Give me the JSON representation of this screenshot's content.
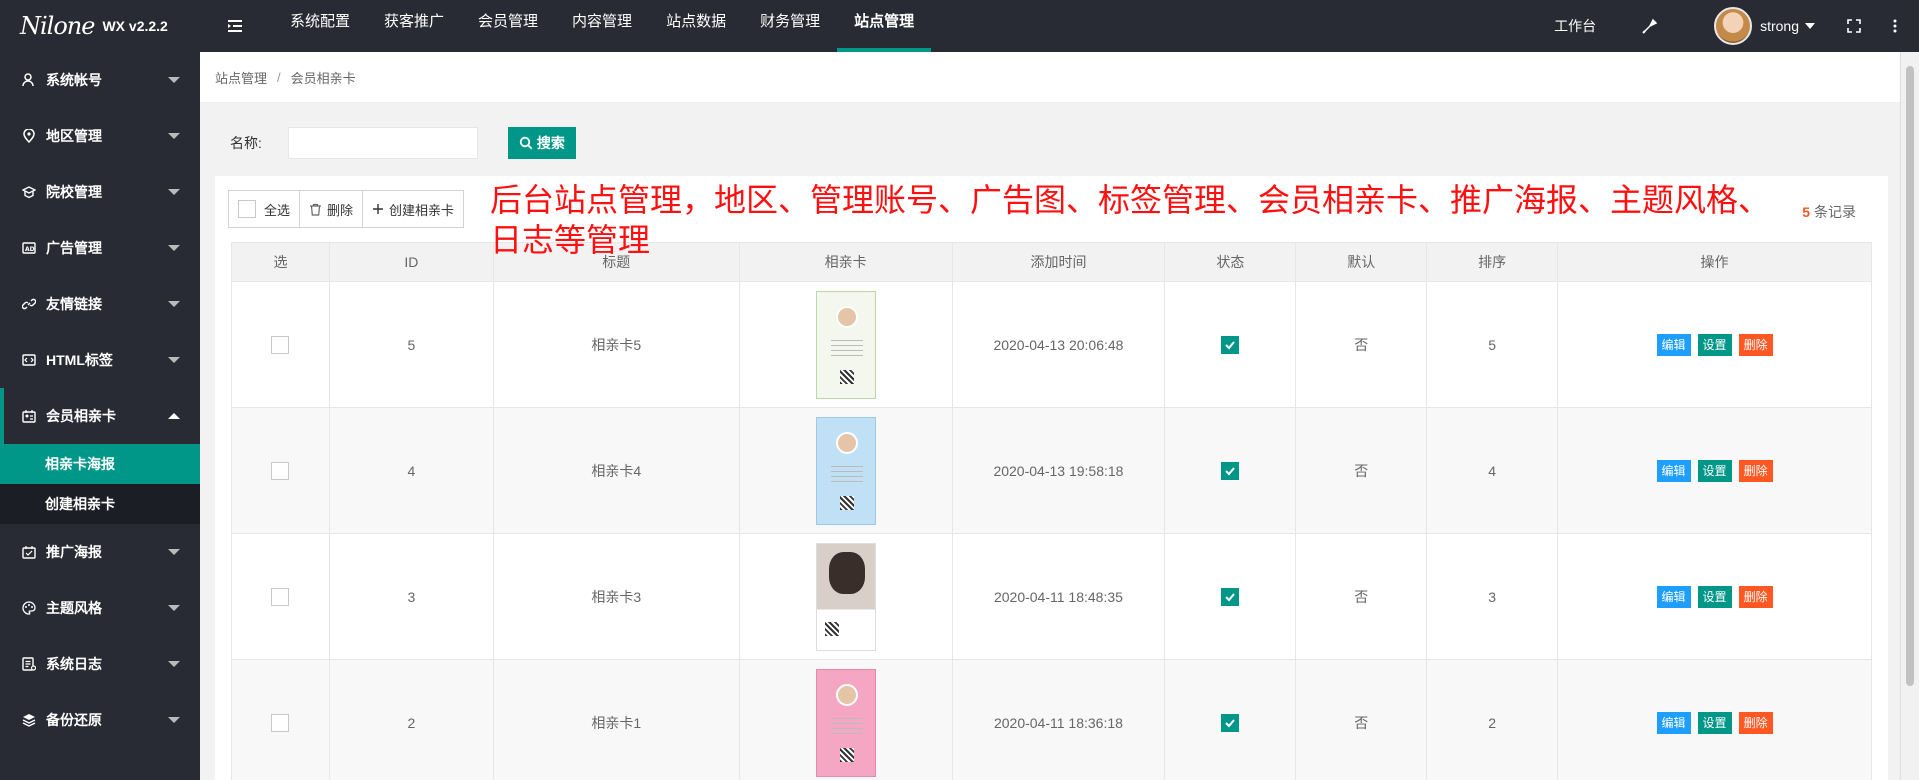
{
  "app": {
    "logo_script": "Nilone",
    "version": "WX v2.2.2"
  },
  "header": {
    "tabs": [
      {
        "label": "系统配置",
        "active": false
      },
      {
        "label": "获客推广",
        "active": false
      },
      {
        "label": "会员管理",
        "active": false
      },
      {
        "label": "内容管理",
        "active": false
      },
      {
        "label": "站点数据",
        "active": false
      },
      {
        "label": "财务管理",
        "active": false
      },
      {
        "label": "站点管理",
        "active": true
      }
    ],
    "workbench": "工作台",
    "username": "strong"
  },
  "sidebar": {
    "items": [
      {
        "label": "系统帐号",
        "icon": "user-icon"
      },
      {
        "label": "地区管理",
        "icon": "location-icon"
      },
      {
        "label": "院校管理",
        "icon": "school-icon"
      },
      {
        "label": "广告管理",
        "icon": "ad-icon"
      },
      {
        "label": "友情链接",
        "icon": "link-icon"
      },
      {
        "label": "HTML标签",
        "icon": "html-icon"
      },
      {
        "label": "会员相亲卡",
        "icon": "card-icon",
        "open": true
      },
      {
        "label": "推广海报",
        "icon": "calendar-icon"
      },
      {
        "label": "主题风格",
        "icon": "palette-icon"
      },
      {
        "label": "系统日志",
        "icon": "log-icon"
      },
      {
        "label": "备份还原",
        "icon": "layers-icon"
      }
    ],
    "sub_items": [
      {
        "label": "相亲卡海报",
        "active": true
      },
      {
        "label": "创建相亲卡",
        "active": false
      }
    ]
  },
  "breadcrumb": {
    "parent": "站点管理",
    "separator": "/",
    "current": "会员相亲卡"
  },
  "search": {
    "label": "名称:",
    "value": "",
    "placeholder": "",
    "button": "搜索"
  },
  "toolbar": {
    "select_all": "全选",
    "delete": "删除",
    "create": "创建相亲卡"
  },
  "records": {
    "count": "5",
    "suffix": "条记录"
  },
  "overlay_text": "后台站点管理，地区、管理账号、广告图、标签管理、会员相亲卡、推广海报、主题风格、日志等管理",
  "table": {
    "columns": [
      "选",
      "ID",
      "标题",
      "相亲卡",
      "添加时间",
      "状态",
      "默认",
      "排序",
      "操作"
    ],
    "rows": [
      {
        "id": "5",
        "title": "相亲卡5",
        "time": "2020-04-13 20:06:48",
        "status": true,
        "default": "否",
        "sort": "5",
        "thumb_bg": "#f3f7ee"
      },
      {
        "id": "4",
        "title": "相亲卡4",
        "time": "2020-04-13 19:58:18",
        "status": true,
        "default": "否",
        "sort": "4",
        "thumb_bg": "#bfe0f5"
      },
      {
        "id": "3",
        "title": "相亲卡3",
        "time": "2020-04-11 18:48:35",
        "status": true,
        "default": "否",
        "sort": "3",
        "thumb_bg": "#ece8e4"
      },
      {
        "id": "2",
        "title": "相亲卡1",
        "time": "2020-04-11 18:36:18",
        "status": true,
        "default": "否",
        "sort": "2",
        "thumb_bg": "#f4a6c2"
      }
    ],
    "ops": {
      "edit": "编辑",
      "set": "设置",
      "delete": "删除"
    }
  },
  "colors": {
    "sidebar_bg": "#282b33",
    "accent": "#009688",
    "edit_btn": "#1e9fff",
    "delete_btn": "#ff5722",
    "overlay": "#ff1010"
  }
}
